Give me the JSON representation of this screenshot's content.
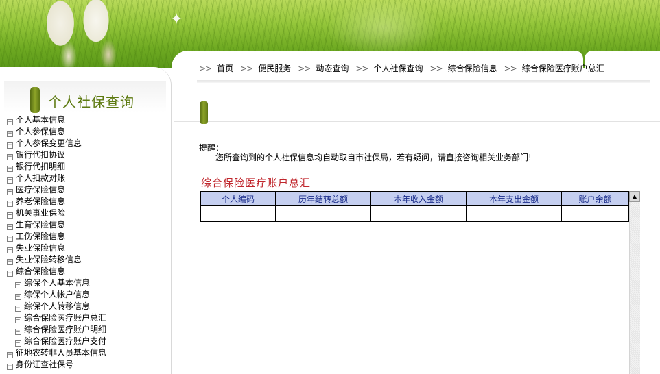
{
  "left_nav": {
    "title": "个人社保查询",
    "items": [
      {
        "label": "个人基本信息",
        "toggle": "⊟",
        "child": false
      },
      {
        "label": "个人参保信息",
        "toggle": "⊟",
        "child": false
      },
      {
        "label": "个人参保变更信息",
        "toggle": "⊟",
        "child": false
      },
      {
        "label": "银行代扣协议",
        "toggle": "⊟",
        "child": false
      },
      {
        "label": "银行代扣明细",
        "toggle": "⊟",
        "child": false
      },
      {
        "label": "个人扣款对账",
        "toggle": "⊟",
        "child": false
      },
      {
        "label": "医疗保险信息",
        "toggle": "⊞",
        "child": false
      },
      {
        "label": "养老保险信息",
        "toggle": "⊞",
        "child": false
      },
      {
        "label": "机关事业保险",
        "toggle": "⊞",
        "child": false
      },
      {
        "label": "生育保险信息",
        "toggle": "⊞",
        "child": false
      },
      {
        "label": "工伤保险信息",
        "toggle": "⊟",
        "child": false
      },
      {
        "label": "失业保险信息",
        "toggle": "⊟",
        "child": false
      },
      {
        "label": "失业保险转移信息",
        "toggle": "⊟",
        "child": false
      },
      {
        "label": "综合保险信息",
        "toggle": "⊞",
        "child": false
      },
      {
        "label": "综保个人基本信息",
        "toggle": "⊟",
        "child": true
      },
      {
        "label": "综保个人帐户信息",
        "toggle": "⊟",
        "child": true
      },
      {
        "label": "综保个人转移信息",
        "toggle": "⊟",
        "child": true
      },
      {
        "label": "综合保险医疗账户总汇",
        "toggle": "⊟",
        "child": true
      },
      {
        "label": "综合保险医疗账户明细",
        "toggle": "⊟",
        "child": true
      },
      {
        "label": "综合保险医疗账户支付",
        "toggle": "⊟",
        "child": true
      },
      {
        "label": "征地农转非人员基本信息",
        "toggle": "⊟",
        "child": false
      },
      {
        "label": "身份证查社保号",
        "toggle": "⊟",
        "child": false
      }
    ]
  },
  "breadcrumb": {
    "separator": ">>",
    "items": [
      "首页",
      "便民服务",
      "动态查询",
      "个人社保查询",
      "综合保险信息",
      "综合保险医疗账户总汇"
    ]
  },
  "notice": {
    "label": "提醒：",
    "text": "您所查询到的个人社保信息均自动取自市社保局，若有疑问，请直接咨询相关业务部门!"
  },
  "result": {
    "title": "综合保险医疗账户总汇",
    "columns": [
      "个人编码",
      "历年结转总额",
      "本年收入金额",
      "本年支出金额",
      "账户余额"
    ],
    "rows": [
      [
        "",
        "",
        "",
        "",
        ""
      ]
    ]
  },
  "scrollbar": {
    "up_arrow": "▲"
  }
}
